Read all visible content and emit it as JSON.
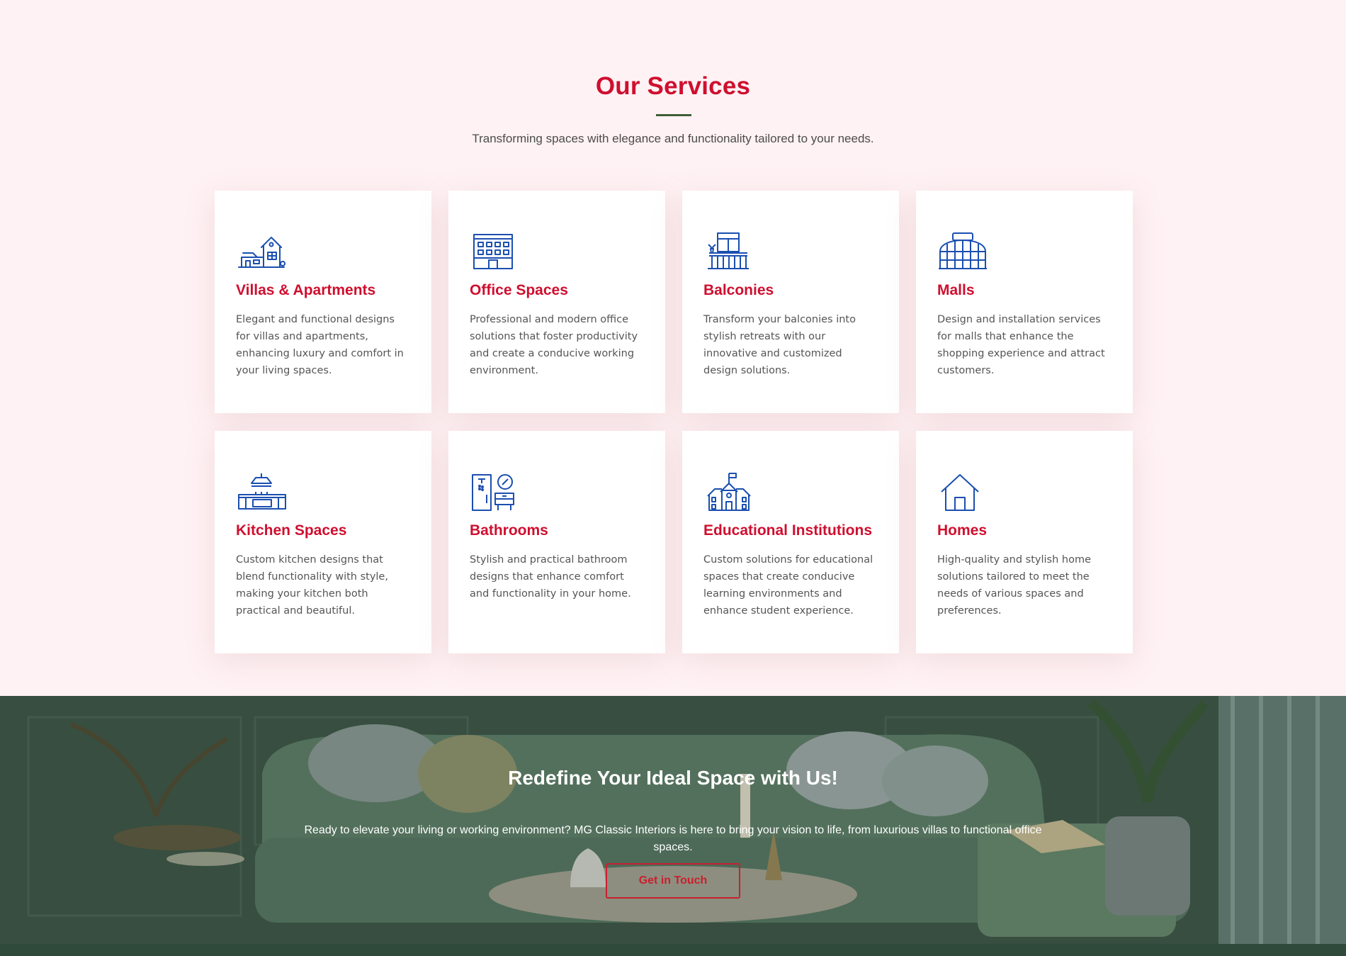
{
  "services": {
    "title": "Our Services",
    "subtitle": "Transforming spaces with elegance and functionality tailored to your needs.",
    "accent_color": "#cf0f2f",
    "divider_color": "#3e5e36",
    "icon_color": "#1b4fb0",
    "cards": [
      {
        "icon": "villa-icon",
        "title": "Villas & Apartments",
        "description": "Elegant and functional designs for villas and apartments, enhancing luxury and comfort in your living spaces."
      },
      {
        "icon": "office-building-icon",
        "title": "Office Spaces",
        "description": "Professional and modern office solutions that foster productivity and create a conducive working environment."
      },
      {
        "icon": "balcony-icon",
        "title": "Balconies",
        "description": "Transform your balconies into stylish retreats with our innovative and customized design solutions."
      },
      {
        "icon": "mall-icon",
        "title": "Malls",
        "description": "Design and installation services for malls that enhance the shopping experience and attract customers."
      },
      {
        "icon": "kitchen-icon",
        "title": "Kitchen Spaces",
        "description": "Custom kitchen designs that blend functionality with style, making your kitchen both practical and beautiful."
      },
      {
        "icon": "bathroom-icon",
        "title": "Bathrooms",
        "description": "Stylish and practical bathroom designs that enhance comfort and functionality in your home."
      },
      {
        "icon": "school-icon",
        "title": "Educational Institutions",
        "description": "Custom solutions for educational spaces that create conducive learning environments and enhance student experience."
      },
      {
        "icon": "home-icon",
        "title": "Homes",
        "description": "High-quality and stylish home solutions tailored to meet the needs of various spaces and preferences."
      }
    ]
  },
  "cta": {
    "title": "Redefine Your Ideal Space with Us!",
    "text": "Ready to elevate your living or working environment? MG Classic Interiors is here to bring your vision to life, from luxurious villas to functional office spaces.",
    "button_label": "Get in Touch",
    "button_color": "#c8202e"
  }
}
